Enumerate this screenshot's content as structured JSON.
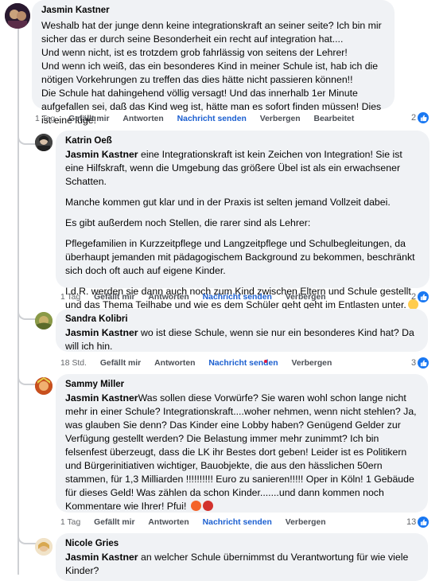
{
  "colors": {
    "accent": "#1877f2",
    "link": "#1b5fd0",
    "bubble": "#f0f2f5",
    "muted": "#65676b"
  },
  "comments": [
    {
      "author": "Jasmin Kastner",
      "body": "Weshalb hat der junge denn keine integrationskraft an seiner seite? Ich bin mir sicher das er durch seine Besonderheit ein recht auf integration hat....\nUnd wenn nicht, ist es trotzdem grob fahrlässig von seitens der Lehrer!\nUnd wenn ich weiß, das ein besonderes Kind in meiner Schule ist, hab ich die nötigen Vorkehrungen zu treffen das dies hätte nicht passieren können!!\nDie Schule hat dahingehend völlig versagt! Und das innerhalb 1er Minute aufgefallen sei, daß das Kind weg ist, hätte man es sofort finden müssen! Dies ist eine lüge!",
      "time": "1 Tag",
      "like": "Gefällt mir",
      "reply": "Antworten",
      "message": "Nachricht senden",
      "hide": "Verbergen",
      "edit": "Bearbeitet",
      "reaction_count": "2",
      "reaction_icon": "like-icon"
    },
    {
      "author": "Katrin Oeß",
      "mention": "Jasmin Kastner",
      "paragraphs": [
        " eine Integrationskraft ist kein Zeichen von Integration! Sie ist eine Hilfskraft, wenn die Umgebung das größere Übel ist als ein erwachsener Schatten.",
        "Manche kommen gut klar und in der Praxis ist selten jemand Vollzeit dabei.",
        "Es gibt außerdem noch Stellen, die rarer sind als Lehrer:",
        "Pflegefamilien in Kurzzeitpflege und Langzeitpflege und Schulbegleitungen, da überhaupt jemanden mit pädagogischem Background zu bekommen, beschränkt sich doch oft auch auf eigene Kinder.",
        "I.d.R. werden sie dann auch noch zum Kind zwischen Eltern und Schule gestellt und das Thema Teilhabe und wie es dem Schüler geht geht im Entlasten unter."
      ],
      "emoji_icon": "rolling-eyes-emoji-icon",
      "time": "1 Tag",
      "like": "Gefällt mir",
      "reply": "Antworten",
      "message": "Nachricht senden",
      "hide": "Verbergen",
      "reaction_count": "2",
      "reaction_icon": "like-icon"
    },
    {
      "author": "Sandra Kolibri",
      "mention": "Jasmin Kastner",
      "body": " wo ist diese Schule, wenn sie nur ein besonderes Kind hat? Da will ich hin.",
      "time": "18 Std.",
      "like": "Gefällt mir",
      "reply": "Antworten",
      "message": "Nachricht senden",
      "hide": "Verbergen",
      "reaction_count": "3",
      "reaction_icon": "like-icon"
    },
    {
      "author": "Sammy Miller",
      "mention": "Jasmin Kastner",
      "body": "Was sollen diese Vorwürfe? Sie waren wohl schon lange nicht mehr in einer Schule? Integrationskraft....woher nehmen, wenn nicht stehlen? Ja, was glauben Sie denn? Das Kinder eine Lobby haben? Genügend Gelder zur Verfügung gestellt werden? Die Belastung immer mehr zunimmt? Ich bin felsenfest überzeugt, dass die LK ihr Bestes dort geben! Leider ist es Politikern und Bürgerinitiativen wichtiger, Bauobjekte, die aus den hässlichen 50ern stammen, für 1,3 Milliarden !!!!!!!!!! Euro zu sanieren!!!!! Oper in Köln! 1 Gebäude für dieses Geld! Was zählen da schon Kinder.......und dann kommen noch Kommentare wie Ihrer! Pfui! ",
      "emoji_icons": [
        "angry-face-icon",
        "cursing-face-icon"
      ],
      "time": "1 Tag",
      "like": "Gefällt mir",
      "reply": "Antworten",
      "message": "Nachricht senden",
      "hide": "Verbergen",
      "reaction_count": "13",
      "reaction_icon": "like-icon"
    },
    {
      "author": "Nicole Gries",
      "mention": "Jasmin Kastner",
      "body": " an welcher Schule übernimmst du Verantwortung für wie viele Kinder?"
    }
  ]
}
